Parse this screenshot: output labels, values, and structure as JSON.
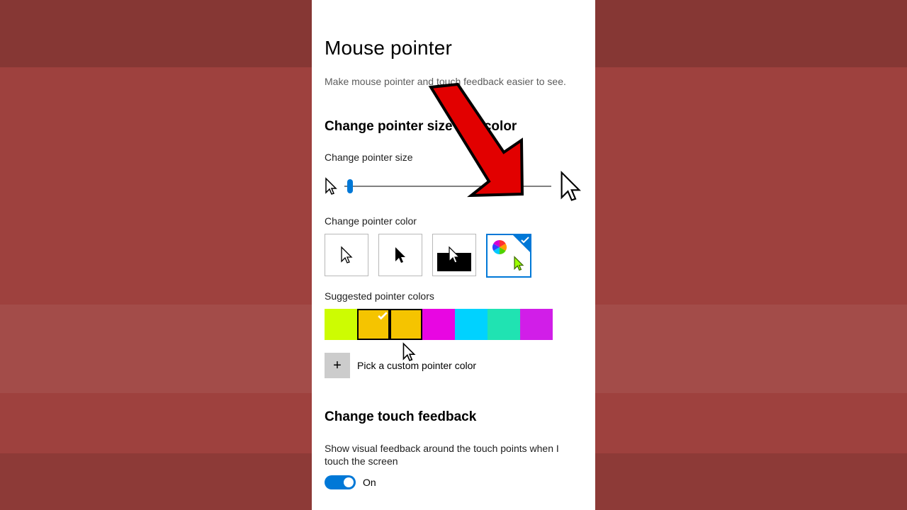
{
  "title": "Mouse pointer",
  "description": "Make mouse pointer and touch feedback easier to see.",
  "section1_title": "Change pointer size and color",
  "size_label": "Change pointer size",
  "color_label": "Change pointer color",
  "suggested_label": "Suggested pointer colors",
  "custom_label": "Pick a custom pointer color",
  "section2_title": "Change touch feedback",
  "touch_desc": "Show visual feedback around the touch points when I touch the screen",
  "toggle_state": "On",
  "pointer_color_options": {
    "white": "White",
    "black": "Black",
    "inverted": "Inverted",
    "custom": "Custom"
  },
  "suggested_colors": [
    "#cdfc02",
    "#f5c400",
    "#f5c400",
    "#e806e2",
    "#00d2ff",
    "#20e3b2",
    "#d11ee8"
  ],
  "selected_suggested_index": 1,
  "hover_suggested_index": 2,
  "accent": "#0078d7",
  "arrow_color": "#e20000"
}
